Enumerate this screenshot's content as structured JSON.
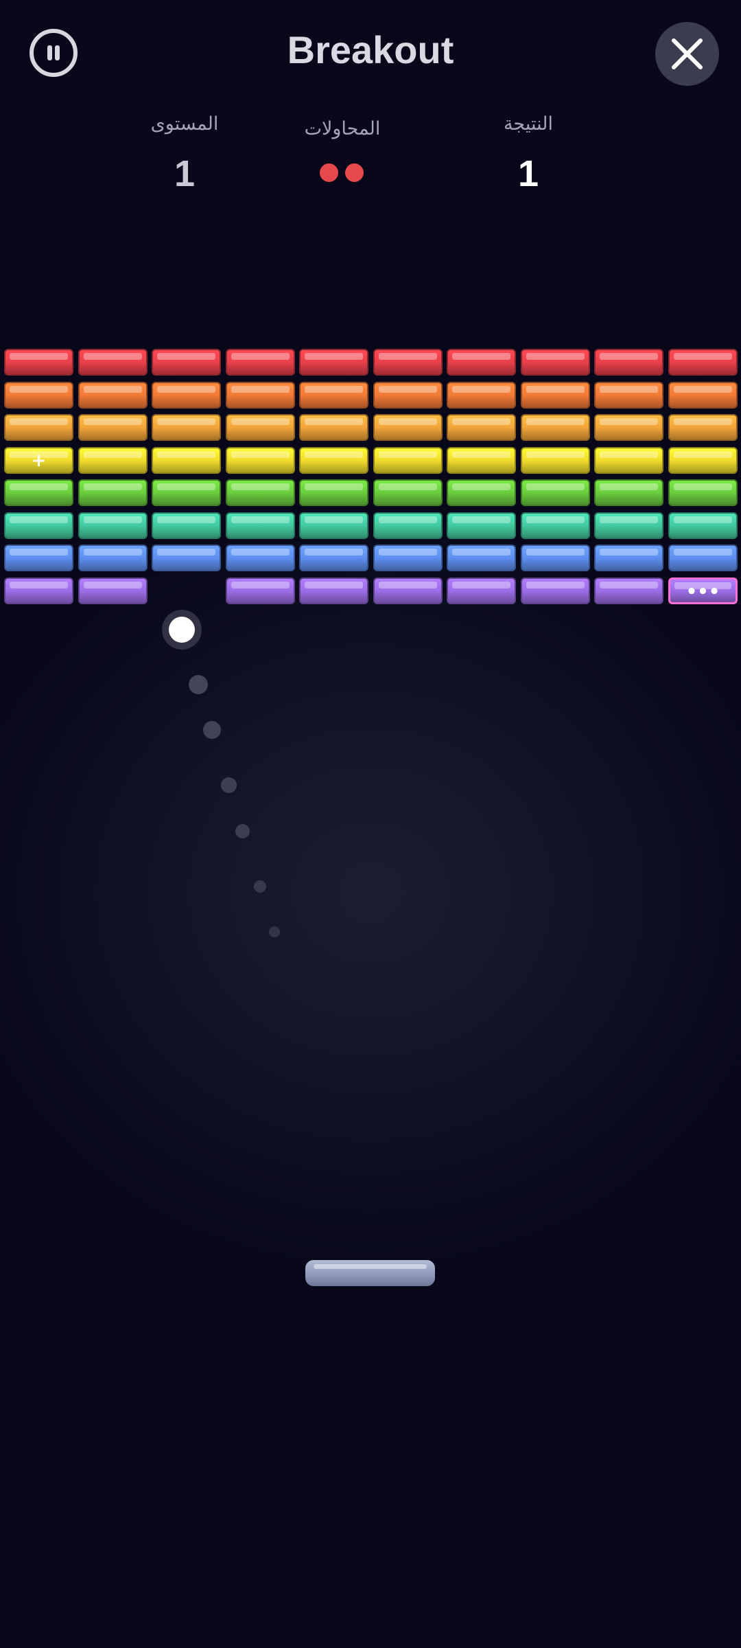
{
  "header": {
    "title": "Breakout"
  },
  "stats": {
    "score_label": "النتيجة",
    "score_value": "1",
    "lives_label": "المحاولات",
    "lives_count": 2,
    "level_label": "المستوى",
    "level_value": "1"
  },
  "colors": {
    "red": "#e8404a",
    "orange": "#f27a37",
    "amber": "#f2a53a",
    "yellow": "#f0dc2c",
    "green": "#6bcc3d",
    "teal": "#43c99f",
    "blue": "#5e8ff0",
    "purple": "#9b6ee6",
    "life": "#e5484d",
    "special_border": "#ff6fd8"
  },
  "bricks": {
    "rows": [
      {
        "color": "red",
        "present": [
          1,
          1,
          1,
          1,
          1,
          1,
          1,
          1,
          1,
          1
        ]
      },
      {
        "color": "orange",
        "present": [
          1,
          1,
          1,
          1,
          1,
          1,
          1,
          1,
          1,
          1
        ]
      },
      {
        "color": "amber",
        "present": [
          1,
          1,
          1,
          1,
          1,
          1,
          1,
          1,
          1,
          1
        ]
      },
      {
        "color": "yellow",
        "present": [
          1,
          1,
          1,
          1,
          1,
          1,
          1,
          1,
          1,
          1
        ]
      },
      {
        "color": "green",
        "present": [
          1,
          1,
          1,
          1,
          1,
          1,
          1,
          1,
          1,
          1
        ]
      },
      {
        "color": "teal",
        "present": [
          1,
          1,
          1,
          1,
          1,
          1,
          1,
          1,
          1,
          1
        ]
      },
      {
        "color": "blue",
        "present": [
          1,
          1,
          1,
          1,
          1,
          1,
          1,
          1,
          1,
          1
        ]
      },
      {
        "color": "purple",
        "present": [
          1,
          1,
          0,
          1,
          1,
          1,
          1,
          1,
          1,
          1
        ]
      }
    ],
    "specials": [
      {
        "row": 3,
        "col": 0,
        "glyph": "+",
        "name": "powerup-plus-brick"
      },
      {
        "row": 7,
        "col": 9,
        "glyph": "•••",
        "name": "powerup-multiball-brick"
      }
    ]
  }
}
